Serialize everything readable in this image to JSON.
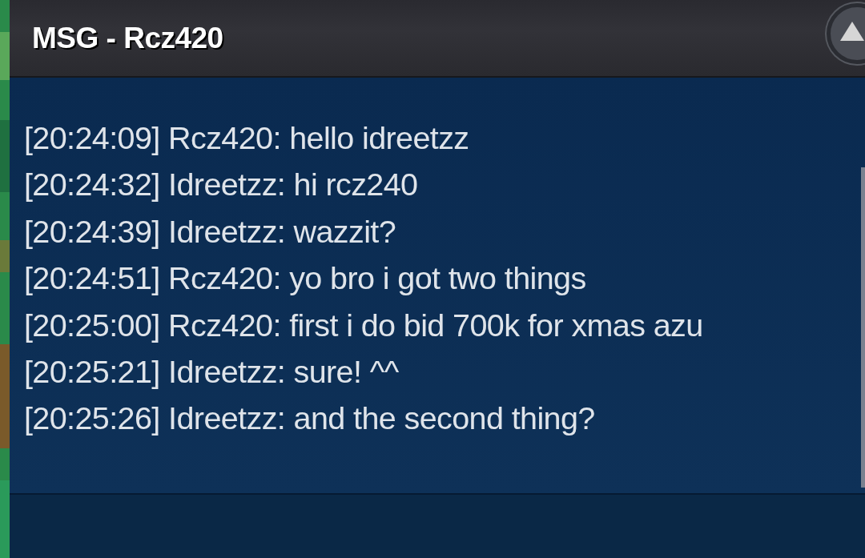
{
  "window": {
    "title": "MSG - Rcz420"
  },
  "messages": [
    {
      "time": "[20:24:09]",
      "sender": "Rcz420:",
      "text": "hello idreetzz"
    },
    {
      "time": "[20:24:32]",
      "sender": "Idreetzz:",
      "text": "hi rcz240"
    },
    {
      "time": "[20:24:39]",
      "sender": "Idreetzz:",
      "text": "wazzit?"
    },
    {
      "time": "[20:24:51]",
      "sender": "Rcz420:",
      "text": "yo bro i got two things"
    },
    {
      "time": "[20:25:00]",
      "sender": "Rcz420:",
      "text": "first i do bid 700k for xmas azu"
    },
    {
      "time": "[20:25:21]",
      "sender": "Idreetzz:",
      "text": "sure! ^^"
    },
    {
      "time": "[20:25:26]",
      "sender": "Idreetzz:",
      "text": "and the second thing?"
    }
  ]
}
